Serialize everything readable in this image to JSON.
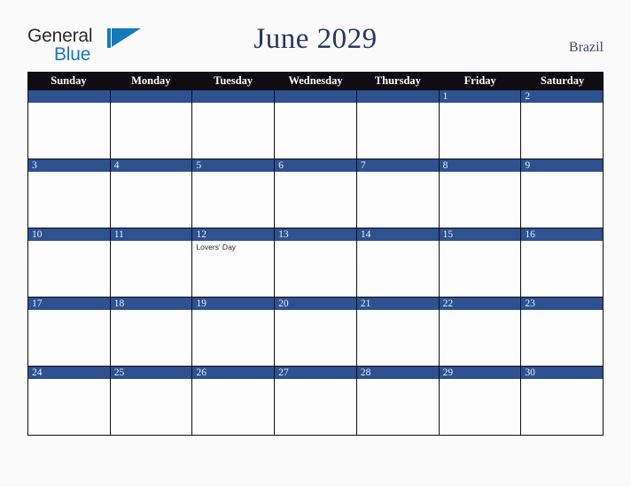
{
  "brand": {
    "name_part1": "General",
    "name_part2": "Blue",
    "triangle_icon": "triangle-logo-icon",
    "color_dark": "#2b2b2b",
    "color_blue": "#1479bd"
  },
  "header": {
    "title": "June 2029",
    "region": "Brazil",
    "title_color": "#26385e"
  },
  "calendar": {
    "month": "June",
    "year": "2029",
    "accent_color": "#2e5190",
    "header_bg": "#0d0d12",
    "day_names": [
      "Sunday",
      "Monday",
      "Tuesday",
      "Wednesday",
      "Thursday",
      "Friday",
      "Saturday"
    ],
    "weeks": [
      [
        {
          "day": "",
          "events": []
        },
        {
          "day": "",
          "events": []
        },
        {
          "day": "",
          "events": []
        },
        {
          "day": "",
          "events": []
        },
        {
          "day": "",
          "events": []
        },
        {
          "day": "1",
          "events": []
        },
        {
          "day": "2",
          "events": []
        }
      ],
      [
        {
          "day": "3",
          "events": []
        },
        {
          "day": "4",
          "events": []
        },
        {
          "day": "5",
          "events": []
        },
        {
          "day": "6",
          "events": []
        },
        {
          "day": "7",
          "events": []
        },
        {
          "day": "8",
          "events": []
        },
        {
          "day": "9",
          "events": []
        }
      ],
      [
        {
          "day": "10",
          "events": []
        },
        {
          "day": "11",
          "events": []
        },
        {
          "day": "12",
          "events": [
            "Lovers' Day"
          ]
        },
        {
          "day": "13",
          "events": []
        },
        {
          "day": "14",
          "events": []
        },
        {
          "day": "15",
          "events": []
        },
        {
          "day": "16",
          "events": []
        }
      ],
      [
        {
          "day": "17",
          "events": []
        },
        {
          "day": "18",
          "events": []
        },
        {
          "day": "19",
          "events": []
        },
        {
          "day": "20",
          "events": []
        },
        {
          "day": "21",
          "events": []
        },
        {
          "day": "22",
          "events": []
        },
        {
          "day": "23",
          "events": []
        }
      ],
      [
        {
          "day": "24",
          "events": []
        },
        {
          "day": "25",
          "events": []
        },
        {
          "day": "26",
          "events": []
        },
        {
          "day": "27",
          "events": []
        },
        {
          "day": "28",
          "events": []
        },
        {
          "day": "29",
          "events": []
        },
        {
          "day": "30",
          "events": []
        }
      ]
    ]
  }
}
